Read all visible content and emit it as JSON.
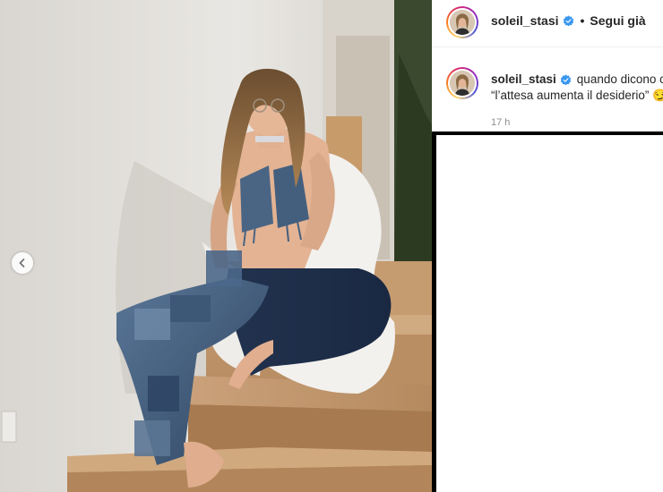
{
  "post": {
    "photo_alt": "woman seated on wooden stairs wearing patchwork jeans and white jacket",
    "carousel_prev_icon": "chevron-left-icon"
  },
  "header": {
    "username": "soleil_stasi",
    "verified_icon": "verified-badge-icon",
    "separator": "•",
    "follow_label": "Segui già"
  },
  "caption": {
    "username": "soleil_stasi",
    "text_line1": "quando dicono c",
    "text_line2": "“l’attesa aumenta il desiderio” 😏",
    "timestamp": "17 h"
  },
  "colors": {
    "verified_blue": "#3897f0",
    "text_primary": "#262626",
    "text_secondary": "#8e8e8e"
  }
}
